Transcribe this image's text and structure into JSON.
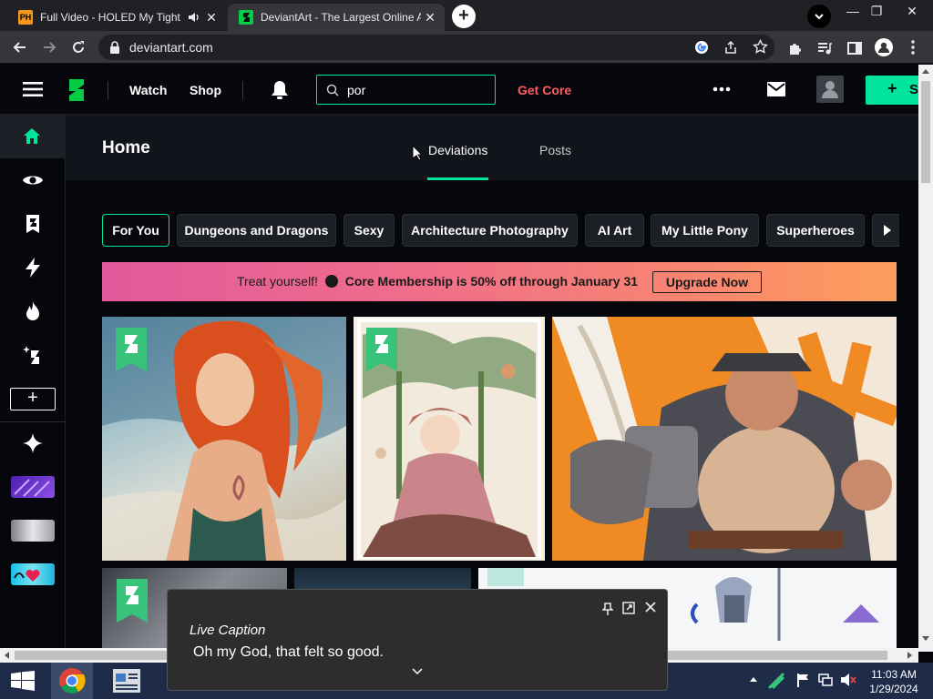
{
  "browser": {
    "tabs": [
      {
        "title": "Full Video - HOLED My Tight",
        "favicon_text": "PH",
        "active": false
      },
      {
        "title": "DeviantArt - The Largest Online A",
        "active": true
      }
    ],
    "url": "deviantart.com"
  },
  "header": {
    "nav": [
      "Watch",
      "Shop"
    ],
    "search_value": "por",
    "get_core": "Get Core",
    "submit_label": "S"
  },
  "page": {
    "title": "Home",
    "tabs": [
      "Deviations",
      "Posts"
    ],
    "active_tab": "Deviations"
  },
  "chips": [
    "For You",
    "Dungeons and Dragons",
    "Sexy",
    "Architecture Photography",
    "AI Art",
    "My Little Pony",
    "Superheroes"
  ],
  "promo": {
    "lead": "Treat yourself!",
    "offer": "Core Membership is 50% off through January 31",
    "button": "Upgrade Now"
  },
  "caption": {
    "title": "Live Caption",
    "text": "Oh my God, that felt so good."
  },
  "clock": {
    "time": "11:03 AM",
    "date": "1/29/2024"
  },
  "colors": {
    "accent": "#00e59b",
    "get_core": "#ff5d5d",
    "promo_start": "#e2599c",
    "promo_end": "#fd9e5c"
  }
}
